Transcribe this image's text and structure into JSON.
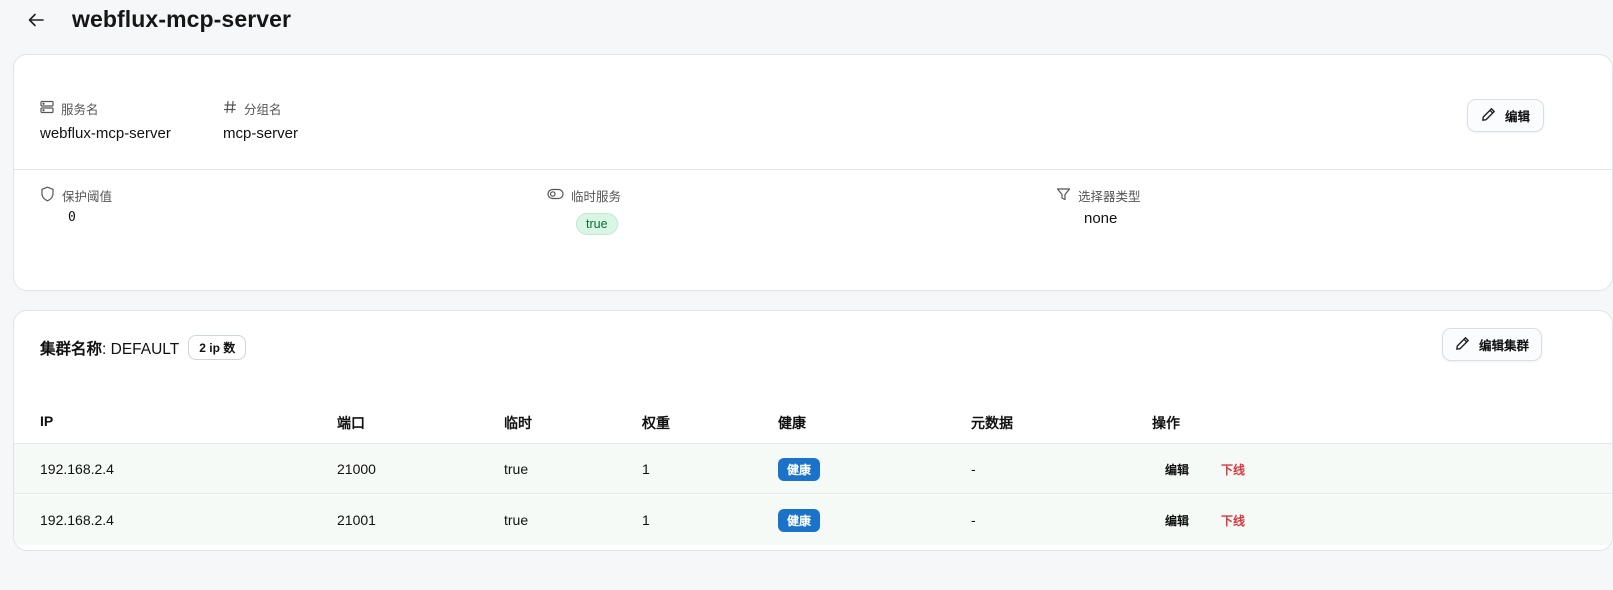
{
  "header": {
    "title": "webflux-mcp-server"
  },
  "service": {
    "name_label": "服务名",
    "name_value": "webflux-mcp-server",
    "group_label": "分组名",
    "group_value": "mcp-server",
    "edit_button": "编辑",
    "protect_label": "保护阈值",
    "protect_value": "0",
    "ephemeral_label": "临时服务",
    "ephemeral_value": "true",
    "selector_label": "选择器类型",
    "selector_value": "none"
  },
  "cluster": {
    "title_prefix": "集群名称",
    "title_name": ": DEFAULT",
    "ip_count": "2 ip 数",
    "edit_button": "编辑集群",
    "columns": [
      "IP",
      "端口",
      "临时",
      "权重",
      "健康",
      "元数据",
      "操作"
    ],
    "rows": [
      {
        "ip": "192.168.2.4",
        "port": "21000",
        "ephemeral": "true",
        "weight": "1",
        "health": "健康",
        "metadata": "-",
        "edit": "编辑",
        "offline": "下线"
      },
      {
        "ip": "192.168.2.4",
        "port": "21001",
        "ephemeral": "true",
        "weight": "1",
        "health": "健康",
        "metadata": "-",
        "edit": "编辑",
        "offline": "下线"
      }
    ]
  },
  "colors": {
    "page_bg": "#f5f7f9",
    "health_badge": "#1a73c9",
    "offline_text": "#d9363e",
    "ephemeral_badge_bg": "#d9f5e4",
    "row_bg": "#f5faf7"
  }
}
